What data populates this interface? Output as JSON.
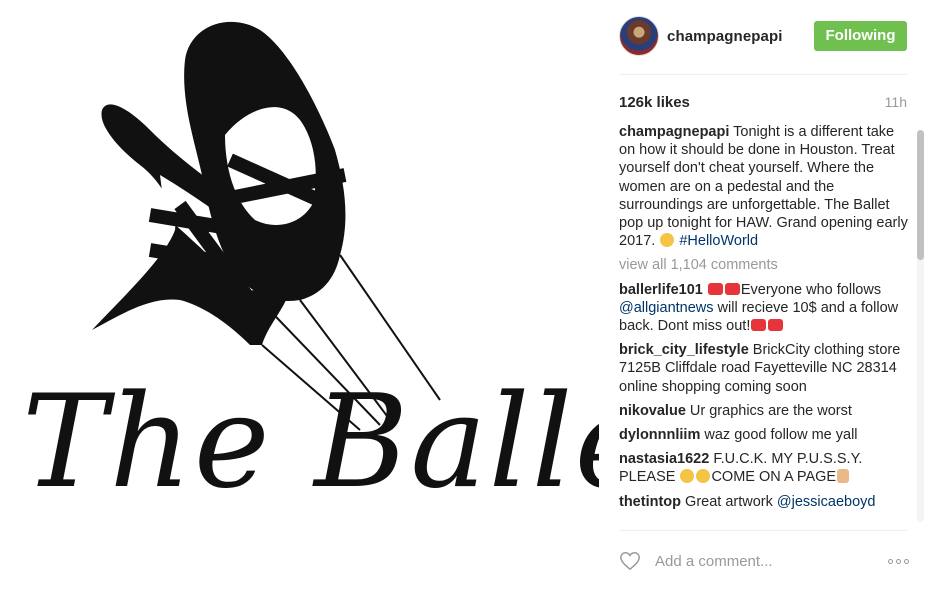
{
  "post": {
    "image_title": "The Ballet"
  },
  "header": {
    "username": "champagnepapi",
    "follow_label": "Following"
  },
  "stats": {
    "likes": "126k likes",
    "time": "11h"
  },
  "caption": {
    "user": "champagnepapi",
    "text": " Tonight is a different take on how it should be done in Houston. Treat yourself don't cheat yourself. Where the women are on a pedestal and the surroundings are unforgettable. The Ballet pop up tonight for HAW. Grand opening early 2017. ",
    "hashtag": "#HelloWorld"
  },
  "view_all": "view all 1,104 comments",
  "comments": [
    {
      "user": "ballerlife101",
      "pre": "",
      "text1": "Everyone who follows ",
      "mention": "@allgiantnews",
      "text2": " will recieve 10$ and a follow back. Dont miss out!"
    },
    {
      "user": "brick_city_lifestyle",
      "text": " BrickCity clothing store 7125B Cliffdale road Fayetteville NC 28314 online shopping coming soon"
    },
    {
      "user": "nikovalue",
      "text": " Ur graphics are the worst"
    },
    {
      "user": "dylonnnliim",
      "text": " waz good follow me yall"
    },
    {
      "user": "nastasia1622",
      "text1": " F.U.C.K. MY P.U.S.S.Y. PLEASE ",
      "text2": "COME ON A PAGE"
    },
    {
      "user": "thetintop",
      "text": " Great artwork ",
      "mention": "@jessicaeboyd"
    }
  ],
  "footer": {
    "add_comment_placeholder": "Add a comment..."
  },
  "colors": {
    "follow_green": "#70c050",
    "link_blue": "#003569",
    "muted": "#999999"
  }
}
